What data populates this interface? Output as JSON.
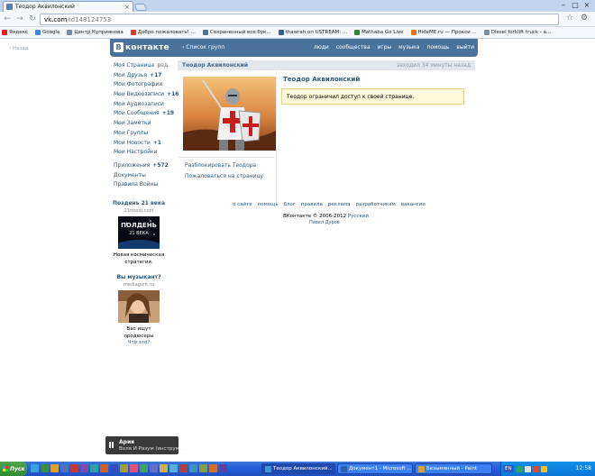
{
  "browser": {
    "tab_title": "Теодор Аквилонский",
    "url_host": "vk.com",
    "url_path": "/id148124753",
    "bookmarks": [
      {
        "label": "Яндекс",
        "color": "#e31b1b"
      },
      {
        "label": "Google",
        "color": "#4285f4"
      },
      {
        "label": "Центр Куприянова",
        "color": "#7a8aa0"
      },
      {
        "label": "Добро пожаловать! ...",
        "color": "#d63a2a"
      },
      {
        "label": "Сохраненный все бук...",
        "color": "#4a729b"
      },
      {
        "label": "thawrah on USTREAM: ...",
        "color": "#3b5998"
      },
      {
        "label": "Mathaba Go Live",
        "color": "#2f8a2f"
      },
      {
        "label": "HideME.ru — Прокси ...",
        "color": "#e07a1f"
      },
      {
        "label": "Diesel forklift truck - a...",
        "color": "#7a8aa0"
      }
    ]
  },
  "vk": {
    "back_link": "Назад",
    "logo_text": "контакте",
    "logo_letter": "В",
    "header_back": "Список групп",
    "nav": [
      "люди",
      "сообщества",
      "игры",
      "музыка",
      "помощь",
      "выйти"
    ],
    "sidebar": {
      "edit": "ред.",
      "items": [
        {
          "label": "Моя Страница",
          "count": ""
        },
        {
          "label": "Мои Друзья",
          "count": "+17"
        },
        {
          "label": "Мои Фотографии",
          "count": ""
        },
        {
          "label": "Мои Видеозаписи",
          "count": "+16"
        },
        {
          "label": "Мои Аудиозаписи",
          "count": ""
        },
        {
          "label": "Мои Сообщения",
          "count": "+19"
        },
        {
          "label": "Мои Заметки",
          "count": ""
        },
        {
          "label": "Мои Группы",
          "count": ""
        },
        {
          "label": "Мои Новости",
          "count": "+1"
        },
        {
          "label": "Мои Настройки",
          "count": ""
        }
      ],
      "items2": [
        {
          "label": "Приложения",
          "count": "+572"
        },
        {
          "label": "Документы",
          "count": ""
        },
        {
          "label": "Правила Войны",
          "count": ""
        }
      ]
    },
    "ads": [
      {
        "title": "Поздень 21 века",
        "domain": "21moon.com",
        "text": "Новая космическая стратегия.",
        "img_text": "ПОЛДЕНЬ\n21 ВЕКА"
      },
      {
        "title": "Вы музыкант?",
        "domain": "mediagunt.ru",
        "text": "Вас ищут продюсеры"
      }
    ],
    "what_is": "Что это?",
    "profile": {
      "head_name": "Теодор Аквилонский",
      "status": "заходил 34 минуты назад",
      "name": "Теодор Аквилонский",
      "notice": "Теодор ограничил доступ к своей странице.",
      "actions": [
        "Разблокировать Теодора",
        "Пожаловаться на страницу"
      ]
    },
    "footer": {
      "links": [
        "о сайте",
        "помощь",
        "блог",
        "правила",
        "реклама",
        "разработчикам",
        "вакансии"
      ],
      "copyright": "ВКонтакте © 2006-2012",
      "language": "Русский",
      "author": "Павел Дуров"
    }
  },
  "notification": {
    "title": "Ария",
    "text": "Воля И Разум (инструм..."
  },
  "taskbar": {
    "start": "Пуск",
    "tasks": [
      {
        "label": "Теодор Аквилонский...",
        "color": "#4a90e2",
        "active": true
      },
      {
        "label": "Документ1 - Microsoft ...",
        "color": "#2b5fb3",
        "active": false
      },
      {
        "label": "Безымянный - Paint",
        "color": "#d6a23a",
        "active": false
      }
    ],
    "lang": "EN",
    "clock": "12:58"
  }
}
